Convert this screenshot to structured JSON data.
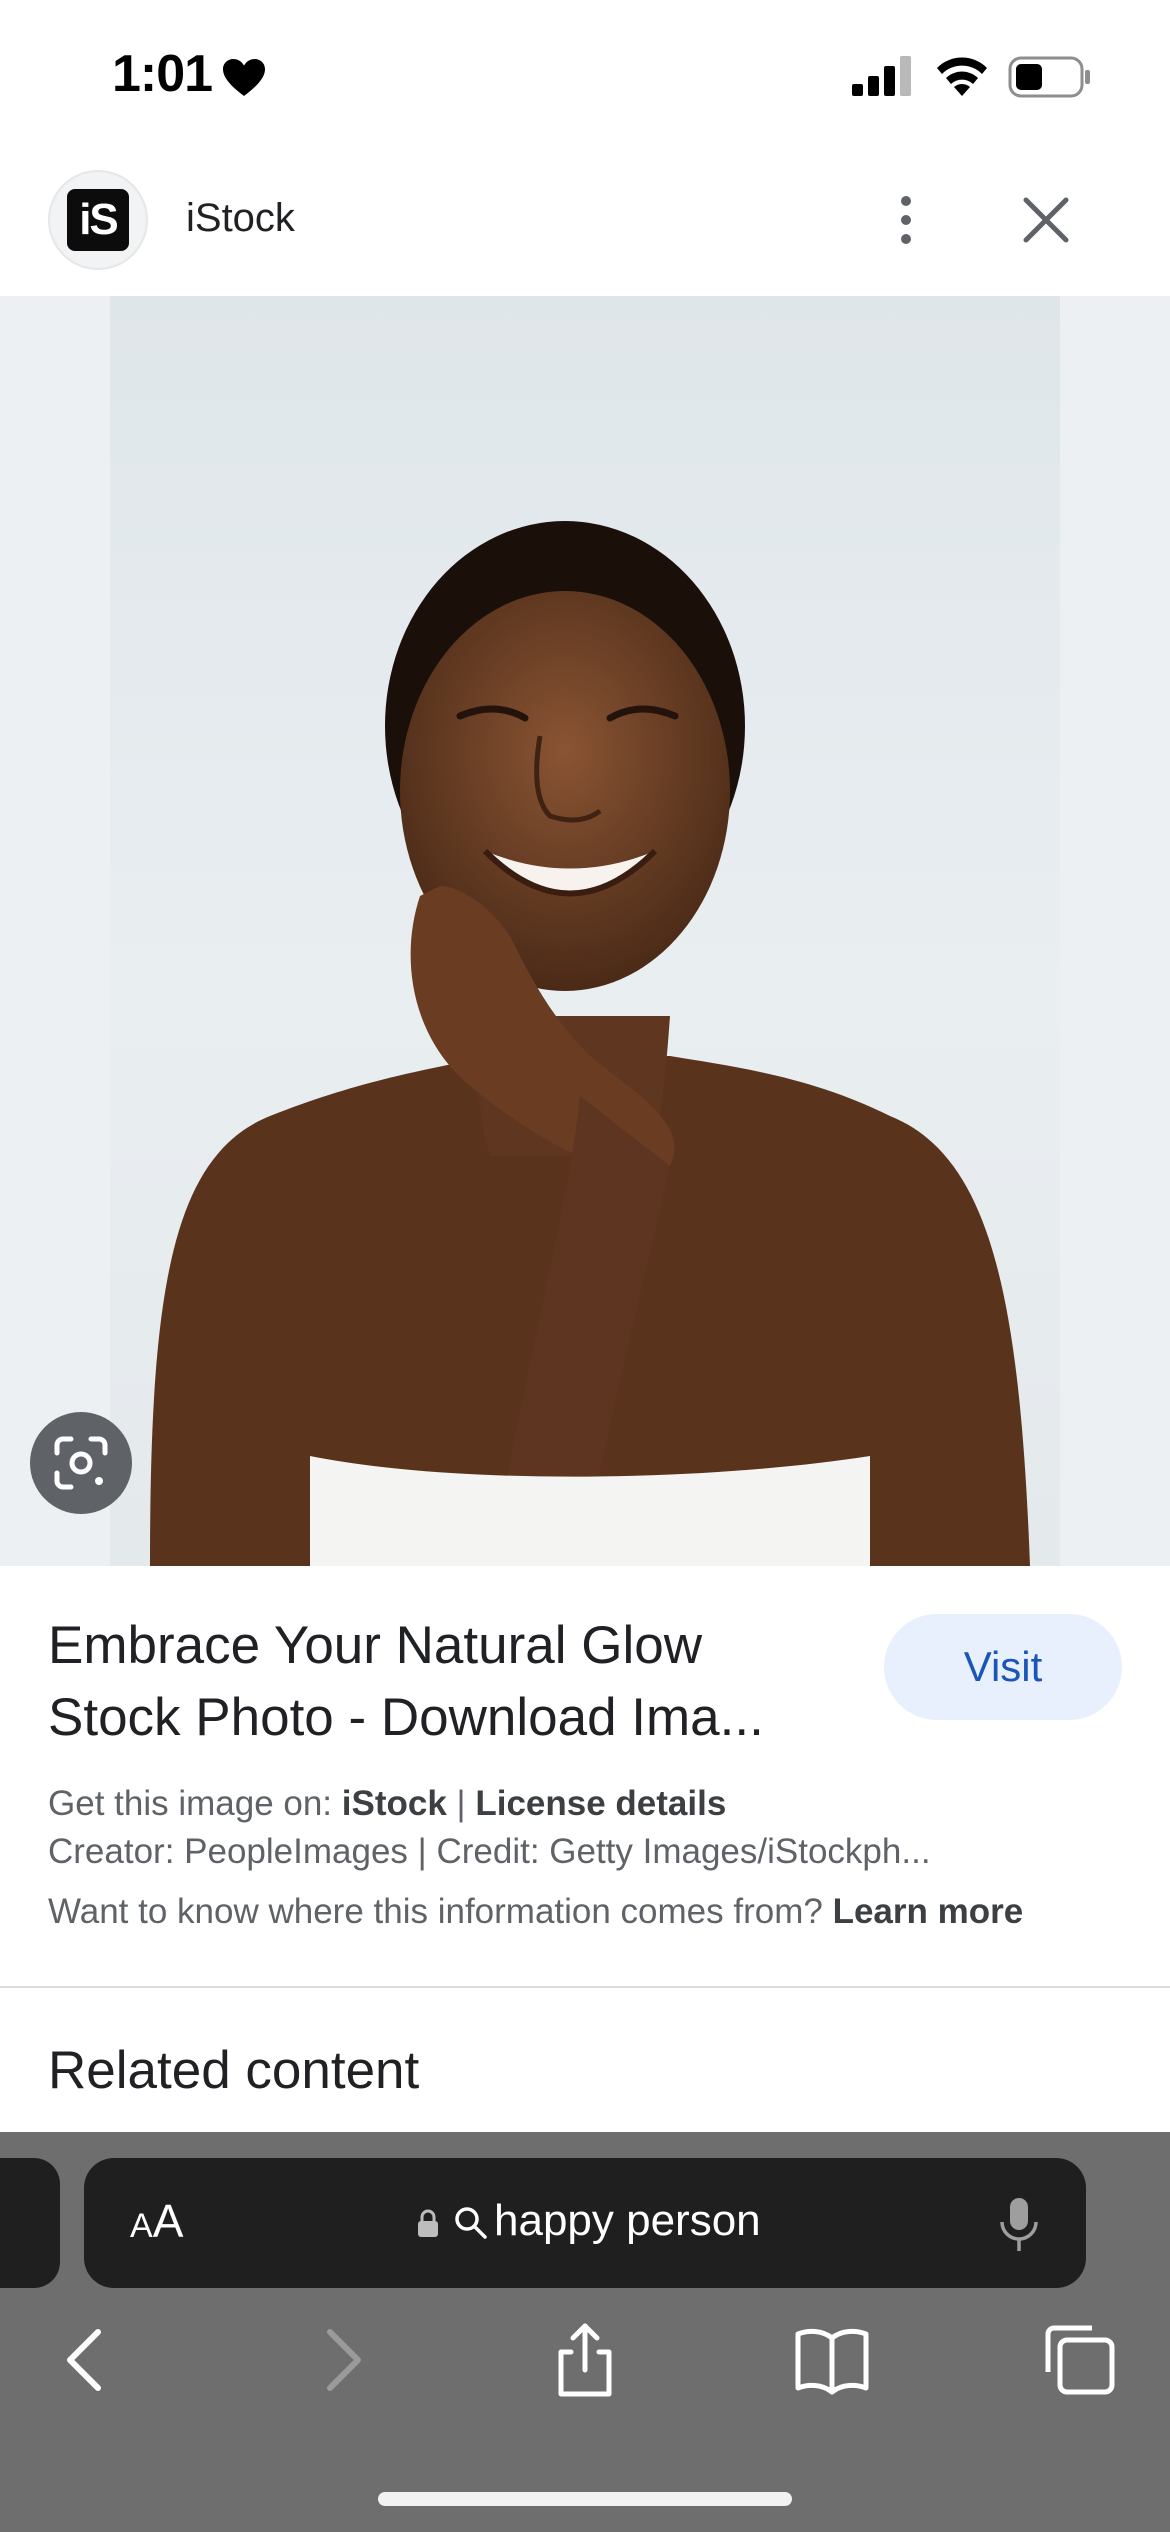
{
  "status_bar": {
    "time": "1:01",
    "icons": [
      "heart-icon",
      "signal-icon",
      "wifi-icon",
      "battery-icon"
    ]
  },
  "source": {
    "logo_text": "iS",
    "name": "iStock",
    "menu_icon": "more-vert-icon",
    "close_icon": "close-icon"
  },
  "image": {
    "lens_icon": "google-lens-icon"
  },
  "info": {
    "title_line1": "Embrace Your Natural Glow",
    "title_line2": "Stock Photo - Download Ima...",
    "visit_label": "Visit",
    "get_image_prefix": "Get this image on: ",
    "get_image_source": "iStock",
    "separator": " | ",
    "license_label": "License details",
    "creator_line": "Creator: PeopleImages | Credit: Getty Images/iStockph...",
    "info_question": "Want to know where this information comes from? ",
    "learn_more": "Learn more"
  },
  "related": {
    "heading": "Related content"
  },
  "browser": {
    "text_size_small": "A",
    "text_size_large": "A",
    "address": "happy person",
    "toolbar_icons": [
      "back-icon",
      "forward-icon",
      "share-icon",
      "bookmarks-icon",
      "tabs-icon"
    ]
  },
  "colors": {
    "visit_bg": "#e8f0fe",
    "visit_text": "#1a56b8",
    "chrome_bg": "#6e6e6e",
    "address_bg": "#1f1f1f"
  }
}
